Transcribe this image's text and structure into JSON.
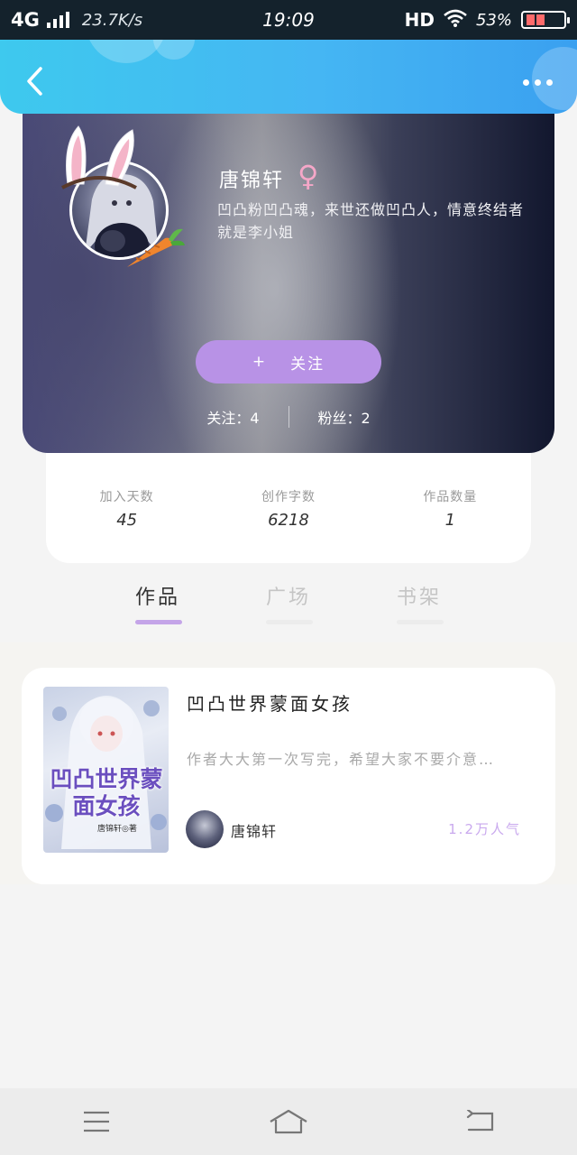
{
  "status_bar": {
    "network": "4G",
    "speed": "23.7K/s",
    "time": "19:09",
    "hd": "HD",
    "battery": "53%"
  },
  "header": {
    "back_icon": "chevron-left-icon",
    "more_icon": "more-dots-icon"
  },
  "profile": {
    "name": "唐锦轩",
    "gender_symbol": "♀",
    "bio": "凹凸粉凹凸魂，来世还做凹凸人，情意终结者就是李小姐",
    "follow_plus": "+",
    "follow_label": "关注",
    "following": "关注：4",
    "fans": "粉丝：2"
  },
  "stats": [
    {
      "label": "加入天数",
      "value": "45"
    },
    {
      "label": "创作字数",
      "value": "6218"
    },
    {
      "label": "作品数量",
      "value": "1"
    }
  ],
  "tabs": [
    {
      "label": "作品",
      "active": true
    },
    {
      "label": "广场",
      "active": false
    },
    {
      "label": "书架",
      "active": false
    }
  ],
  "book": {
    "cover_title": "凹凸世界蒙面女孩",
    "cover_author": "唐锦轩◎著",
    "title": "凹凸世界蒙面女孩",
    "description": "作者大大第一次写完，希望大家不要介意…",
    "author": "唐锦轩",
    "popularity": "1.2万人气"
  },
  "colors": {
    "header_gradient_start": "#3ec9ee",
    "header_gradient_end": "#3aa0f0",
    "follow_button": "#b892e6",
    "active_tab_underline": "#c4a4e8",
    "popularity_text": "#c9a9ee"
  },
  "nav": {
    "menu_icon": "menu-icon",
    "home_icon": "home-icon",
    "back_icon": "back-arrow-icon"
  }
}
